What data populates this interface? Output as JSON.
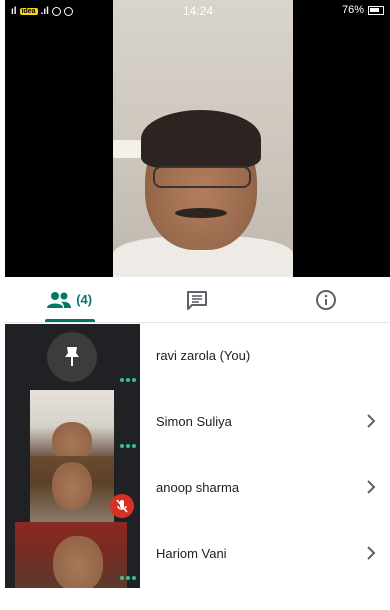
{
  "status_bar": {
    "signal_left": "̣̣̣:ıl",
    "carrier": "idea",
    "signal_mid": "..ıl",
    "time": "14:24",
    "battery": "76%"
  },
  "tabs": [
    {
      "name": "people",
      "icon": "people-icon",
      "count": "(4)",
      "active": true
    },
    {
      "name": "chat",
      "icon": "chat-icon",
      "active": false
    },
    {
      "name": "info",
      "icon": "info-icon",
      "active": false
    }
  ],
  "participants": [
    {
      "name": "ravi zarola (You)",
      "has_chevron": false,
      "muted": false
    },
    {
      "name": "Simon Suliya",
      "has_chevron": true,
      "muted": false
    },
    {
      "name": "anoop sharma",
      "has_chevron": true,
      "muted": true
    },
    {
      "name": "Hariom Vani",
      "has_chevron": true,
      "muted": false
    }
  ],
  "colors": {
    "accent": "#00796b",
    "speaking_dots": "#35c39a",
    "muted": "#d93025"
  }
}
